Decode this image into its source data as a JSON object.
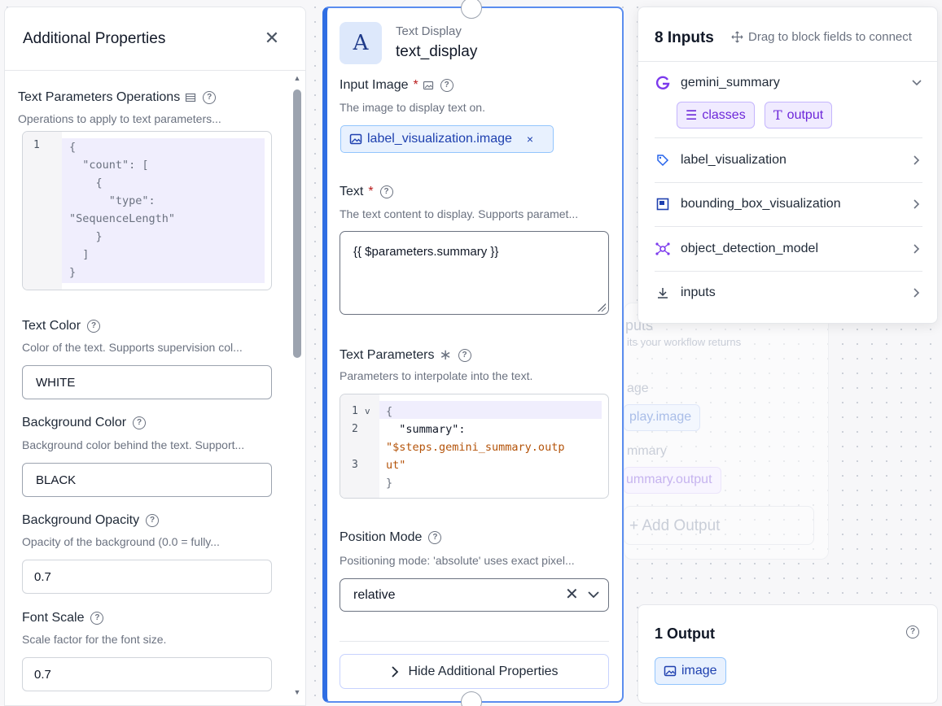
{
  "additional_properties": {
    "title": "Additional Properties",
    "close_icon": "close-icon",
    "fields": {
      "text_parameters_operations": {
        "label": "Text Parameters Operations",
        "description": "Operations to apply to text parameters...",
        "code_line_number": "1",
        "code_value": "{\n  \"count\": [\n    {\n      \"type\":\n\"SequenceLength\"\n    }\n  ]\n}"
      },
      "text_color": {
        "label": "Text Color",
        "description": "Color of the text. Supports supervision col...",
        "value": "WHITE"
      },
      "background_color": {
        "label": "Background Color",
        "description": "Background color behind the text. Support...",
        "value": "BLACK"
      },
      "background_opacity": {
        "label": "Background Opacity",
        "description": "Opacity of the background (0.0 = fully...",
        "value": "0.7"
      },
      "font_scale": {
        "label": "Font Scale",
        "description": "Scale factor for the font size.",
        "value": "0.7"
      }
    }
  },
  "block": {
    "type_label": "Text Display",
    "name": "text_display",
    "icon_letter": "A",
    "input_image": {
      "label": "Input Image",
      "required_mark": "*",
      "description": "The image to display text on.",
      "chip_value": "label_visualization.image",
      "chip_remove": "×"
    },
    "text": {
      "label": "Text",
      "required_mark": "*",
      "description": "The text content to display. Supports paramet...",
      "value": "{{ $parameters.summary }}"
    },
    "text_parameters": {
      "label": "Text Parameters",
      "description": "Parameters to interpolate into the text.",
      "line_numbers": [
        "1",
        "2",
        "",
        "3"
      ],
      "fold_marker": "v",
      "code_line1": "{",
      "code_key": "  \"summary\":",
      "code_value_a": "\"$steps.gemini_summary.outp",
      "code_value_b": "ut\"",
      "code_close": "}"
    },
    "position_mode": {
      "label": "Position Mode",
      "description": "Positioning mode: 'absolute' uses exact pixel...",
      "selected": "relative"
    },
    "hide_button_label": "Hide Additional Properties"
  },
  "inputs_panel": {
    "title": "8 Inputs",
    "drag_hint": "Drag to block fields to connect",
    "items": [
      {
        "label": "gemini_summary",
        "icon": "gemini-icon",
        "expanded": true
      },
      {
        "label": "label_visualization",
        "icon": "tag-icon",
        "expanded": false
      },
      {
        "label": "bounding_box_visualization",
        "icon": "bounding-box-icon",
        "expanded": false
      },
      {
        "label": "object_detection_model",
        "icon": "model-graph-icon",
        "expanded": false
      },
      {
        "label": "inputs",
        "icon": "download-icon",
        "expanded": false
      }
    ],
    "gemini_fields": [
      "classes",
      "output"
    ]
  },
  "output_panel": {
    "title": "1 Output",
    "chip": "image"
  },
  "background": {
    "outputs_heading": "puts",
    "outputs_desc": "its your workflow returns",
    "row1_label": "age",
    "row1_chip": "play.image",
    "row2_label": "mmary",
    "row2_chip": "ummary.output",
    "add_output": "+ Add Output"
  },
  "colors": {
    "accent_blue": "#2f6ee3",
    "chip_blue_bg": "#e8f1fe",
    "chip_purple_bg": "#f0ebff",
    "gemini_purple": "#6d28d9"
  }
}
